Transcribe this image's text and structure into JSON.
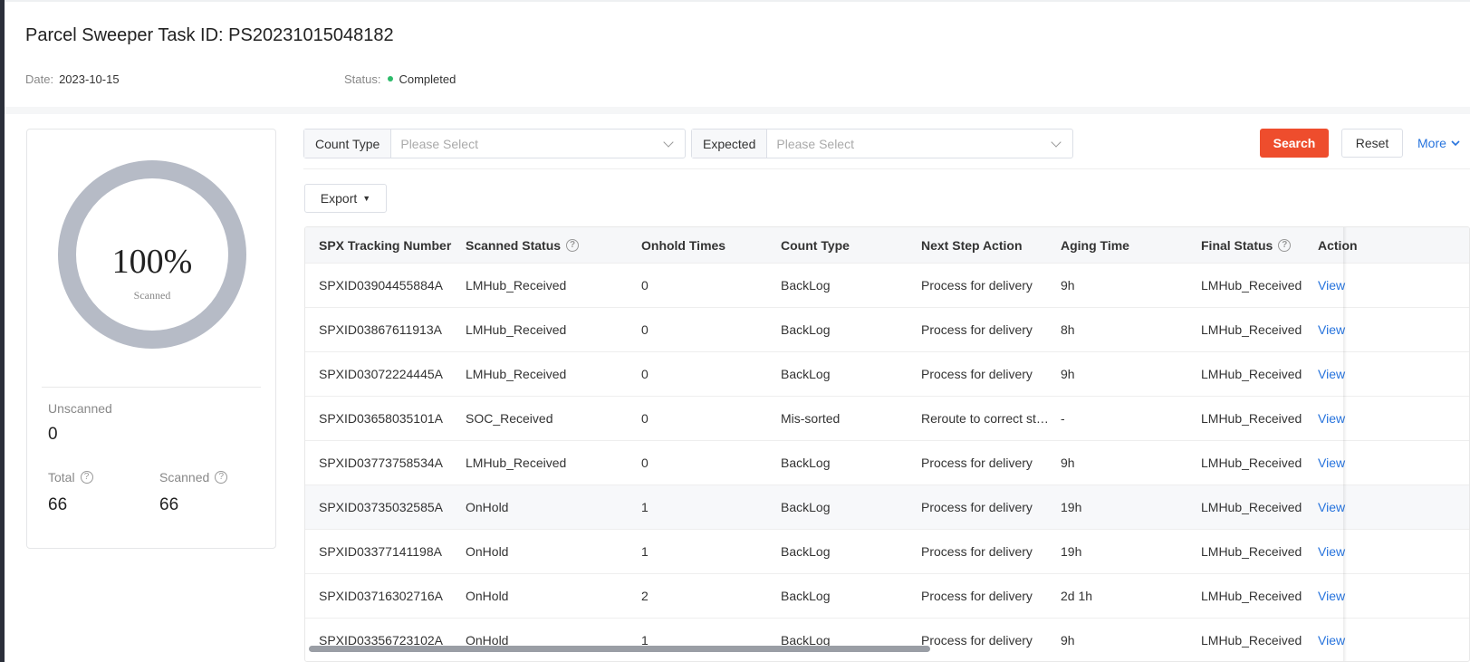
{
  "header": {
    "title": "Parcel Sweeper Task ID: PS20231015048182",
    "date_label": "Date:",
    "date_value": "2023-10-15",
    "status_label": "Status:",
    "status_value": "Completed",
    "status_color": "#2dbb6a"
  },
  "summary": {
    "progress_percent": "100%",
    "progress_label": "Scanned",
    "unscanned_label": "Unscanned",
    "unscanned_value": "0",
    "total_label": "Total",
    "total_value": "66",
    "scanned_label": "Scanned",
    "scanned_value": "66",
    "help_icon": "question-circle-icon"
  },
  "filters": {
    "count_type_label": "Count Type",
    "count_type_placeholder": "Please Select",
    "expected_label": "Expected",
    "expected_placeholder": "Please Select",
    "search_label": "Search",
    "reset_label": "Reset",
    "more_label": "More",
    "accent_color": "#ee4d2d",
    "link_color": "#2673dd"
  },
  "toolbar": {
    "export_label": "Export"
  },
  "table": {
    "columns": [
      "SPX Tracking Number",
      "Scanned Status",
      "Onhold Times",
      "Count Type",
      "Next Step Action",
      "Aging Time",
      "Final Status",
      "Action"
    ],
    "rows": [
      [
        "SPXID03904455884A",
        "LMHub_Received",
        "0",
        "BackLog",
        "Process for delivery",
        "9h",
        "LMHub_Received",
        "View"
      ],
      [
        "SPXID03867611913A",
        "LMHub_Received",
        "0",
        "BackLog",
        "Process for delivery",
        "8h",
        "LMHub_Received",
        "View"
      ],
      [
        "SPXID03072224445A",
        "LMHub_Received",
        "0",
        "BackLog",
        "Process for delivery",
        "9h",
        "LMHub_Received",
        "View"
      ],
      [
        "SPXID03658035101A",
        "SOC_Received",
        "0",
        "Mis-sorted",
        "Reroute to correct sta...",
        "-",
        "LMHub_Received",
        "View"
      ],
      [
        "SPXID03773758534A",
        "LMHub_Received",
        "0",
        "BackLog",
        "Process for delivery",
        "9h",
        "LMHub_Received",
        "View"
      ],
      [
        "SPXID03735032585A",
        "OnHold",
        "1",
        "BackLog",
        "Process for delivery",
        "19h",
        "LMHub_Received",
        "View"
      ],
      [
        "SPXID03377141198A",
        "OnHold",
        "1",
        "BackLog",
        "Process for delivery",
        "19h",
        "LMHub_Received",
        "View"
      ],
      [
        "SPXID03716302716A",
        "OnHold",
        "2",
        "BackLog",
        "Process for delivery",
        "2d 1h",
        "LMHub_Received",
        "View"
      ],
      [
        "SPXID03356723102A",
        "OnHold",
        "1",
        "BackLog",
        "Process for delivery",
        "9h",
        "LMHub_Received",
        "View"
      ]
    ]
  }
}
